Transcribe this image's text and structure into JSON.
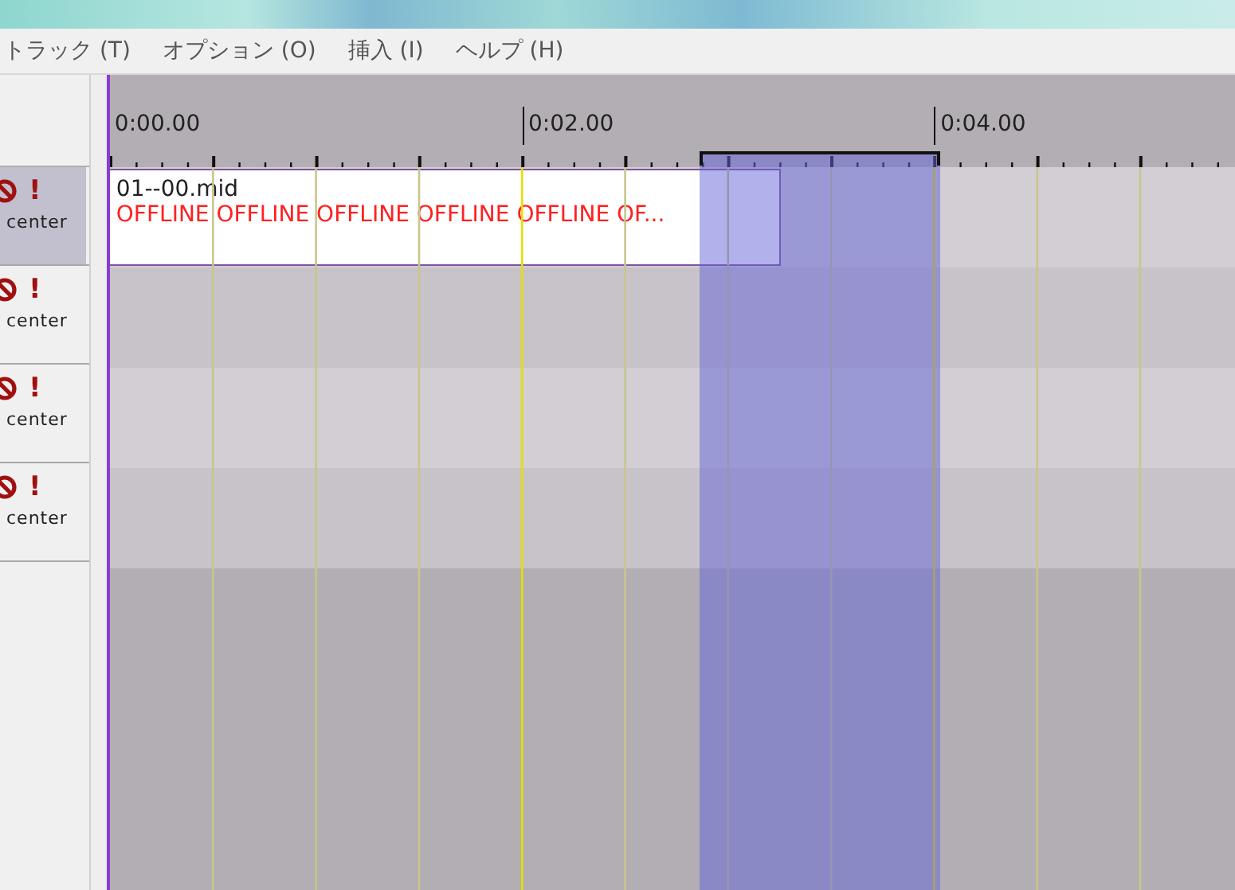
{
  "menu": [
    {
      "label": "トラック (T)"
    },
    {
      "label": "オプション (O)"
    },
    {
      "label": "挿入 (I)"
    },
    {
      "label": "ヘルプ (H)"
    }
  ],
  "ruler": {
    "labels": [
      "0:00.00",
      "0:02.00",
      "0:04.00"
    ]
  },
  "tracks": [
    {
      "selected": true,
      "mark": "!",
      "label": "center"
    },
    {
      "selected": false,
      "mark": "!",
      "label": "center"
    },
    {
      "selected": false,
      "mark": "!",
      "label": "center"
    },
    {
      "selected": false,
      "mark": "!",
      "label": "center"
    }
  ],
  "clip": {
    "name": "01--00.mid",
    "status": "OFFLINE OFFLINE OFFLINE OFFLINE OFFLINE OF..."
  }
}
